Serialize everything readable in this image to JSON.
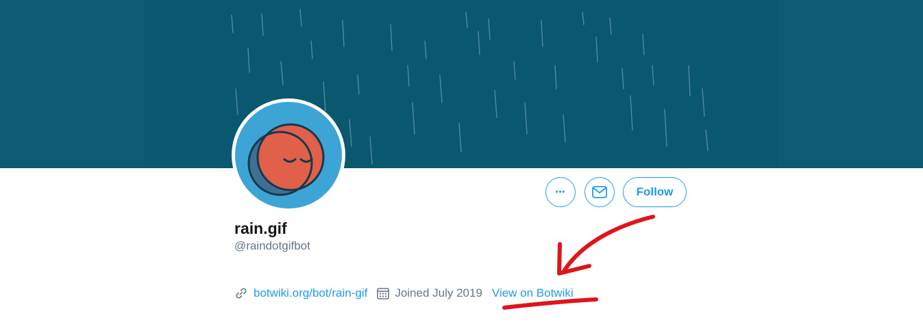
{
  "profile": {
    "display_name": "rain.gif",
    "handle": "@raindotgifbot",
    "bio_emoji": "🌧",
    "website": "botwiki.org/bot/rain-gif",
    "joined": "Joined July 2019",
    "botwiki_link": "View on Botwiki"
  },
  "actions": {
    "more_label": "•••",
    "follow_label": "Follow"
  },
  "colors": {
    "banner": "#0a5770",
    "avatar_bg": "#3da4d6",
    "accent": "#1d9bf0",
    "annotation": "#e0141b"
  }
}
